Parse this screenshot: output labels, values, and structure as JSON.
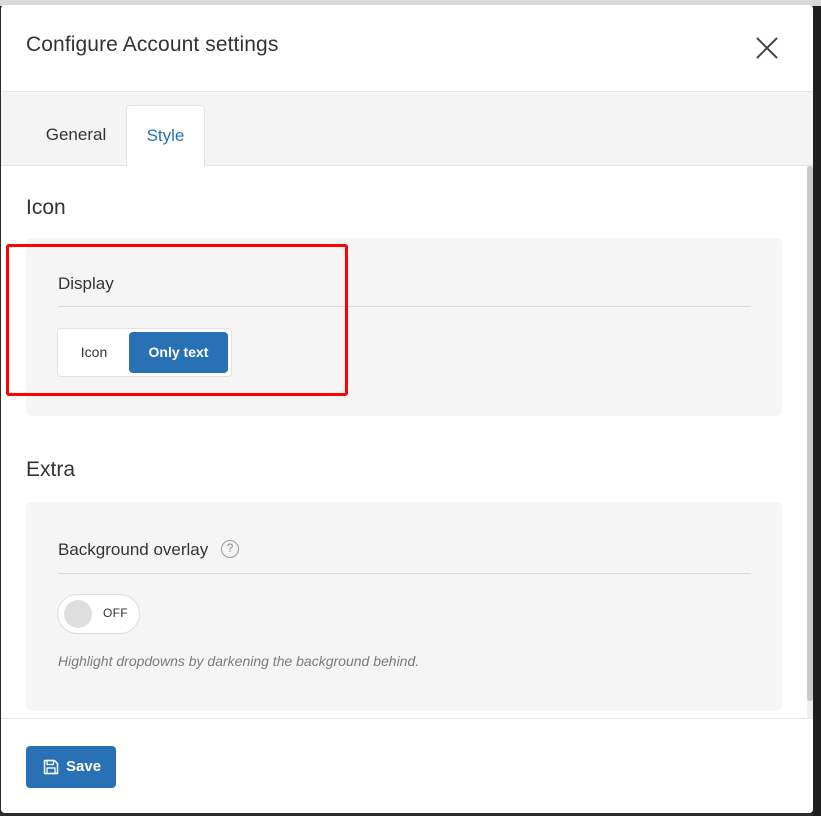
{
  "modal": {
    "title": "Configure Account settings"
  },
  "tabs": [
    {
      "label": "General",
      "active": false
    },
    {
      "label": "Style",
      "active": true
    }
  ],
  "sections": {
    "icon": {
      "title": "Icon",
      "display_label": "Display",
      "options": [
        "Icon",
        "Only text"
      ],
      "selected": "Only text"
    },
    "extra": {
      "title": "Extra",
      "overlay_label": "Background overlay",
      "help_glyph": "?",
      "toggle_state": "OFF",
      "hint": "Highlight dropdowns by darkening the background behind."
    }
  },
  "footer": {
    "save_label": "Save"
  },
  "colors": {
    "accent": "#2771b4",
    "highlight": "#ff0000"
  },
  "icons": [
    "close-icon",
    "question-mark-icon",
    "floppy-disk-icon"
  ]
}
